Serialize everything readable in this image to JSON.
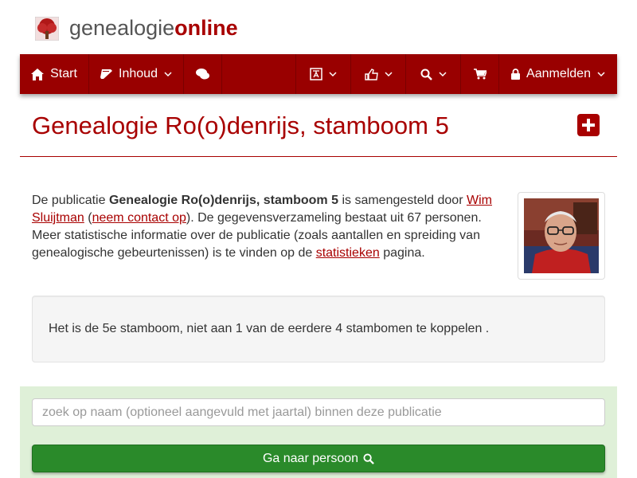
{
  "brand": {
    "name_part1": "genealogie",
    "name_part2": "online",
    "accent_color": "#a80000"
  },
  "nav": {
    "start_label": "Start",
    "inhoud_label": "Inhoud",
    "login_label": "Aanmelden",
    "icons": [
      "home-icon",
      "book-icon",
      "chat-icon",
      "translate-icon",
      "thumbs-up-icon",
      "search-icon",
      "cart-icon",
      "lock-icon"
    ]
  },
  "page": {
    "title": "Genealogie Ro(o)denrijs, stamboom 5"
  },
  "intro": {
    "prefix": "De publicatie ",
    "publication": "Genealogie Ro(o)denrijs, stamboom 5",
    "middle1": " is samengesteld door ",
    "author": "Wim Sluijtman",
    "paren_open": " (",
    "contact": "neem contact op",
    "middle2": "). De gegevensverzameling bestaat uit 67 personen. Meer statistische informatie over de publicatie (zoals aantallen en spreiding van genealogische gebeurtenissen) is te vinden op de ",
    "stats_link": "statistieken",
    "suffix": " pagina."
  },
  "note": {
    "text": "Het is de 5e stamboom, niet aan 1 van de eerdere 4 stambomen te koppelen ."
  },
  "search": {
    "placeholder": "zoek op naam (optioneel aangevuld met jaartal) binnen deze publicatie",
    "value": "",
    "button_label": "Ga naar persoon",
    "button_color": "#2a8a2a",
    "panel_color": "#dff0d8"
  }
}
